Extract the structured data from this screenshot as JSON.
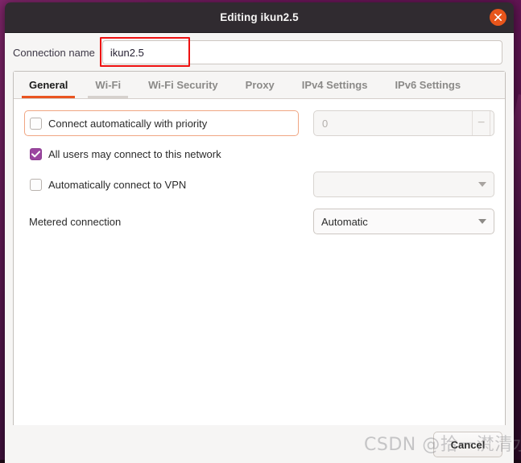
{
  "window": {
    "title": "Editing ikun2.5",
    "close_icon": "close-icon"
  },
  "connection": {
    "name_label": "Connection name",
    "name_value": "ikun2.5",
    "name_placeholder": ""
  },
  "tabs": [
    {
      "label": "General",
      "active": true
    },
    {
      "label": "Wi-Fi",
      "active": false
    },
    {
      "label": "Wi-Fi Security",
      "active": false
    },
    {
      "label": "Proxy",
      "active": false
    },
    {
      "label": "IPv4 Settings",
      "active": false
    },
    {
      "label": "IPv6 Settings",
      "active": false
    }
  ],
  "general": {
    "connect_auto": {
      "label": "Connect automatically with priority",
      "checked": false,
      "priority_value": "0",
      "minus_label": "−",
      "plus_label": "+"
    },
    "all_users": {
      "label": "All users may connect to this network",
      "checked": true
    },
    "auto_vpn": {
      "label": "Automatically connect to VPN",
      "checked": false,
      "vpn_value": ""
    },
    "metered": {
      "label": "Metered connection",
      "value": "Automatic"
    }
  },
  "footer": {
    "cancel_label": "Cancel"
  },
  "watermark": {
    "text": "CSDN @拾一滼清水"
  },
  "colors": {
    "accent": "#e95420",
    "checkbox_checked": "#9b45a0",
    "titlebar": "#302b30",
    "annotation": "#ee1111",
    "focus_border": "#f0a683"
  }
}
